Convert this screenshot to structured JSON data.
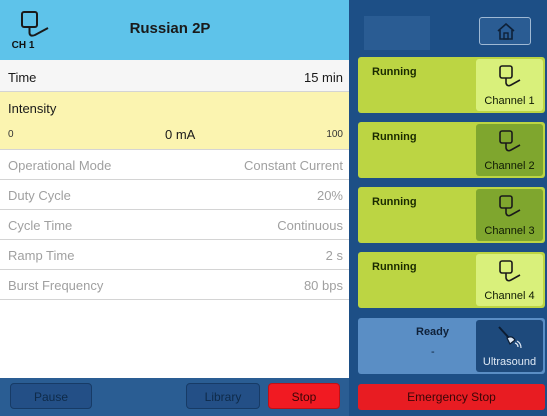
{
  "header": {
    "channel_label": "CH 1",
    "protocol": "Russian 2P"
  },
  "time": {
    "label": "Time",
    "value": "15 min"
  },
  "intensity": {
    "label": "Intensity",
    "min": "0",
    "current": "0 mA",
    "max": "100"
  },
  "params": [
    {
      "label": "Operational Mode",
      "value": "Constant Current"
    },
    {
      "label": "Duty Cycle",
      "value": "20%"
    },
    {
      "label": "Cycle Time",
      "value": "Continuous"
    },
    {
      "label": "Ramp Time",
      "value": "2 s"
    },
    {
      "label": "Burst Frequency",
      "value": "80 bps"
    }
  ],
  "footer": {
    "pause": "Pause",
    "library": "Library",
    "stop": "Stop"
  },
  "channels": [
    {
      "status": "Running",
      "label": "Channel 1"
    },
    {
      "status": "Running",
      "label": "Channel 2"
    },
    {
      "status": "Running",
      "label": "Channel 3"
    },
    {
      "status": "Running",
      "label": "Channel 4"
    }
  ],
  "ultrasound": {
    "status": "Ready",
    "detail": "-",
    "label": "Ultrasound"
  },
  "emergency_label": "Emergency Stop",
  "icons": {
    "channel": "electrode-lead-icon",
    "home": "home-icon",
    "ultrasound": "ultrasound-probe-icon"
  },
  "colors": {
    "header": "#5ec3ea",
    "intensity_highlight": "#fbf4b0",
    "running_card": "#bcd543",
    "channel_button": "#7fa62e",
    "stop": "#f11a22",
    "panel_blue": "#1d4f86"
  }
}
